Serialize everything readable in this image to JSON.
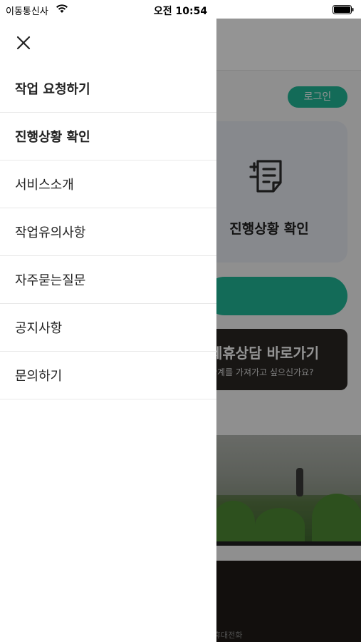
{
  "status_bar": {
    "carrier": "이동통신사",
    "time": "오전 10:54"
  },
  "background": {
    "login_label": "로그인",
    "progress_card_label": "진행상황 확인",
    "banner_title": "제휴상담 바로가기",
    "banner_subtitle": "관계를 가져가고 싶으신가요?",
    "footer_text": "휴대전화"
  },
  "drawer": {
    "items": [
      {
        "label": "작업 요청하기"
      },
      {
        "label": "진행상황 확인"
      },
      {
        "label": "서비스소개"
      },
      {
        "label": "작업유의사항"
      },
      {
        "label": "자주묻는질문"
      },
      {
        "label": "공지사항"
      },
      {
        "label": "문의하기"
      }
    ]
  },
  "colors": {
    "accent": "#22b898",
    "drawer_background": "#ffffff",
    "overlay": "rgba(0,0,0,0.42)"
  },
  "icons": {
    "close": "close-icon",
    "wifi": "wifi-icon",
    "battery": "battery-icon",
    "progress": "document-list-icon"
  }
}
